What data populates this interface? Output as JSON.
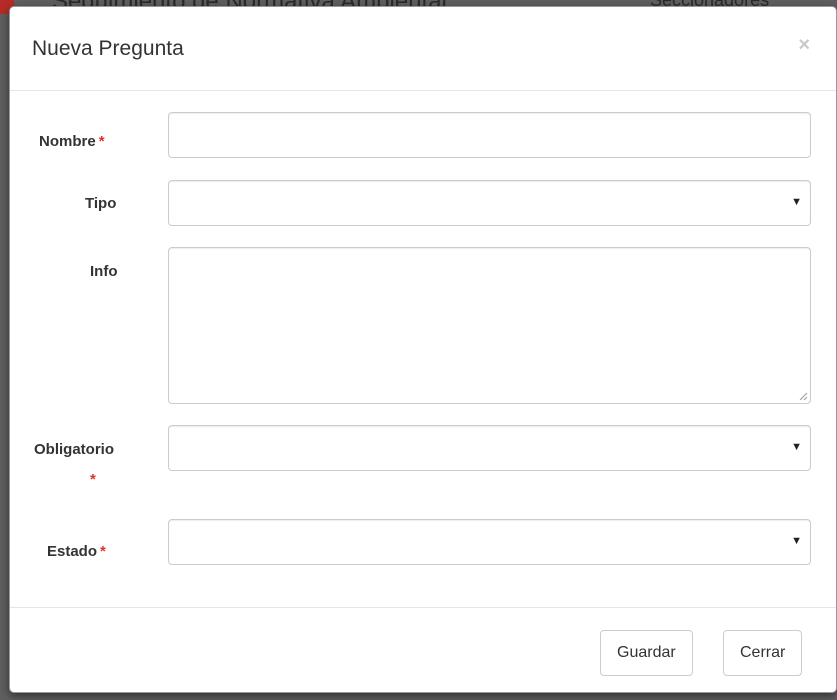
{
  "background": {
    "title": "Seguimiento de Normativa Ambiental",
    "right_text": "Seccionadores"
  },
  "modal": {
    "title": "Nueva Pregunta",
    "close_label": "×"
  },
  "form": {
    "required_marker": "*",
    "nombre": {
      "label": "Nombre",
      "value": "",
      "required": true
    },
    "tipo": {
      "label": "Tipo",
      "selected": ""
    },
    "info": {
      "label": "Info",
      "value": ""
    },
    "obligatorio": {
      "label": "Obligatorio",
      "selected": "",
      "required": true
    },
    "estado": {
      "label": "Estado",
      "selected": "",
      "required": true
    }
  },
  "footer": {
    "save_label": "Guardar",
    "close_label": "Cerrar"
  },
  "colors": {
    "required": "#d9342b",
    "border": "#cccccc",
    "text": "#333333"
  },
  "icons": {
    "select_caret": "caret-down-icon",
    "close": "close-icon",
    "textarea_grip": "resize-grip-icon"
  }
}
